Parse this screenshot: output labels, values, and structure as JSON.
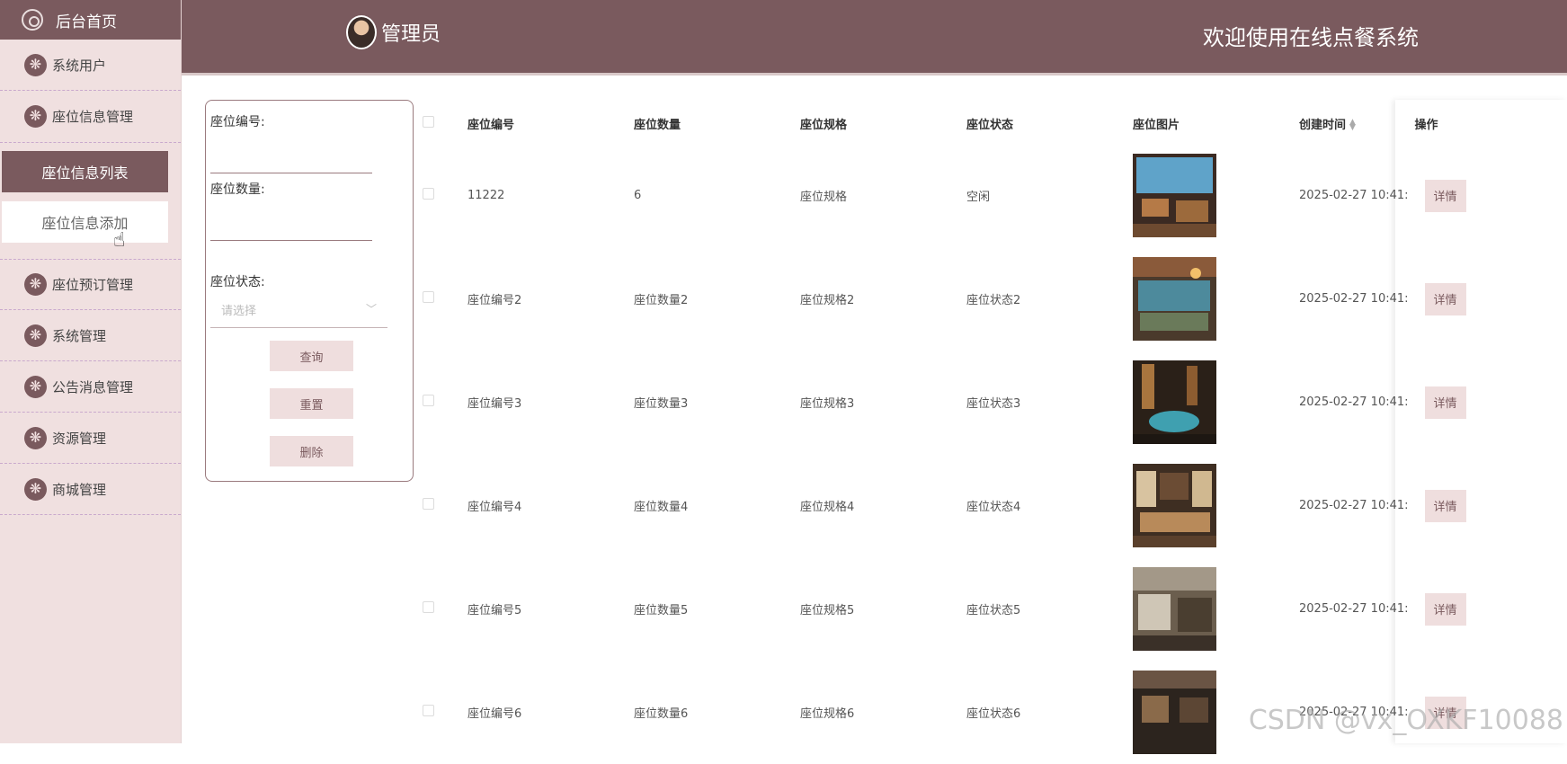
{
  "sidebar": {
    "home": "后台首页",
    "items": [
      "系统用户",
      "座位信息管理",
      "座位预订管理",
      "系统管理",
      "公告消息管理",
      "资源管理",
      "商城管理"
    ],
    "submenu": [
      "座位信息列表",
      "座位信息添加"
    ]
  },
  "header": {
    "admin": "管理员",
    "welcome": "欢迎使用在线点餐系统"
  },
  "search": {
    "seat_no_label": "座位编号:",
    "seat_count_label": "座位数量:",
    "seat_status_label": "座位状态:",
    "status_placeholder": "请选择",
    "query_button": "查询",
    "reset_button": "重置",
    "delete_button": "删除"
  },
  "table": {
    "headers": [
      "座位编号",
      "座位数量",
      "座位规格",
      "座位状态",
      "座位图片",
      "创建时间",
      "操作"
    ],
    "detail_label": "详情",
    "rows": [
      {
        "no": "11222",
        "count": "6",
        "spec": "座位规格",
        "status": "空闲",
        "time": "2025-02-27 10:41:"
      },
      {
        "no": "座位编号2",
        "count": "座位数量2",
        "spec": "座位规格2",
        "status": "座位状态2",
        "time": "2025-02-27 10:41:"
      },
      {
        "no": "座位编号3",
        "count": "座位数量3",
        "spec": "座位规格3",
        "status": "座位状态3",
        "time": "2025-02-27 10:41:"
      },
      {
        "no": "座位编号4",
        "count": "座位数量4",
        "spec": "座位规格4",
        "status": "座位状态4",
        "time": "2025-02-27 10:41:"
      },
      {
        "no": "座位编号5",
        "count": "座位数量5",
        "spec": "座位规格5",
        "status": "座位状态5",
        "time": "2025-02-27 10:41:"
      },
      {
        "no": "座位编号6",
        "count": "座位数量6",
        "spec": "座位规格6",
        "status": "座位状态6",
        "time": "2025-02-27 10:41:"
      }
    ]
  },
  "watermark": "CSDN @vx_OXKF10088"
}
